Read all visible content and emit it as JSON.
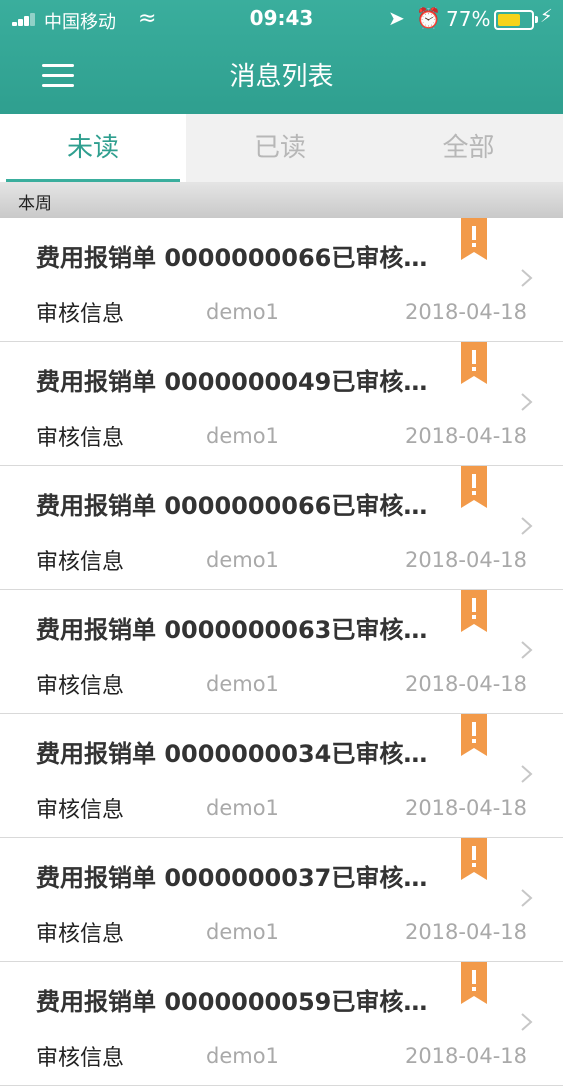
{
  "status_bar": {
    "carrier": "中国移动",
    "time": "09:43",
    "battery_percent": "77%",
    "battery_level": 0.6
  },
  "nav": {
    "title": "消息列表",
    "menu_icon": "hamburger-menu-icon"
  },
  "tabs": [
    {
      "label": "未读",
      "active": true
    },
    {
      "label": "已读",
      "active": false
    },
    {
      "label": "全部",
      "active": false
    }
  ],
  "section": {
    "label": "本周"
  },
  "messages": [
    {
      "title": "费用报销单 0000000066已审核…",
      "info": "审核信息",
      "sender": "demo1",
      "date": "2018-04-18"
    },
    {
      "title": "费用报销单 0000000049已审核…",
      "info": "审核信息",
      "sender": "demo1",
      "date": "2018-04-18"
    },
    {
      "title": "费用报销单 0000000066已审核…",
      "info": "审核信息",
      "sender": "demo1",
      "date": "2018-04-18"
    },
    {
      "title": "费用报销单 0000000063已审核…",
      "info": "审核信息",
      "sender": "demo1",
      "date": "2018-04-18"
    },
    {
      "title": "费用报销单 0000000034已审核…",
      "info": "审核信息",
      "sender": "demo1",
      "date": "2018-04-18"
    },
    {
      "title": "费用报销单 0000000037已审核…",
      "info": "审核信息",
      "sender": "demo1",
      "date": "2018-04-18"
    },
    {
      "title": "费用报销单 0000000059已审核…",
      "info": "审核信息",
      "sender": "demo1",
      "date": "2018-04-18"
    }
  ],
  "colors": {
    "header": "#3aae9d",
    "accent": "#2f9f8f",
    "flag": "#f29a4a",
    "battery": "#f7d31b"
  }
}
